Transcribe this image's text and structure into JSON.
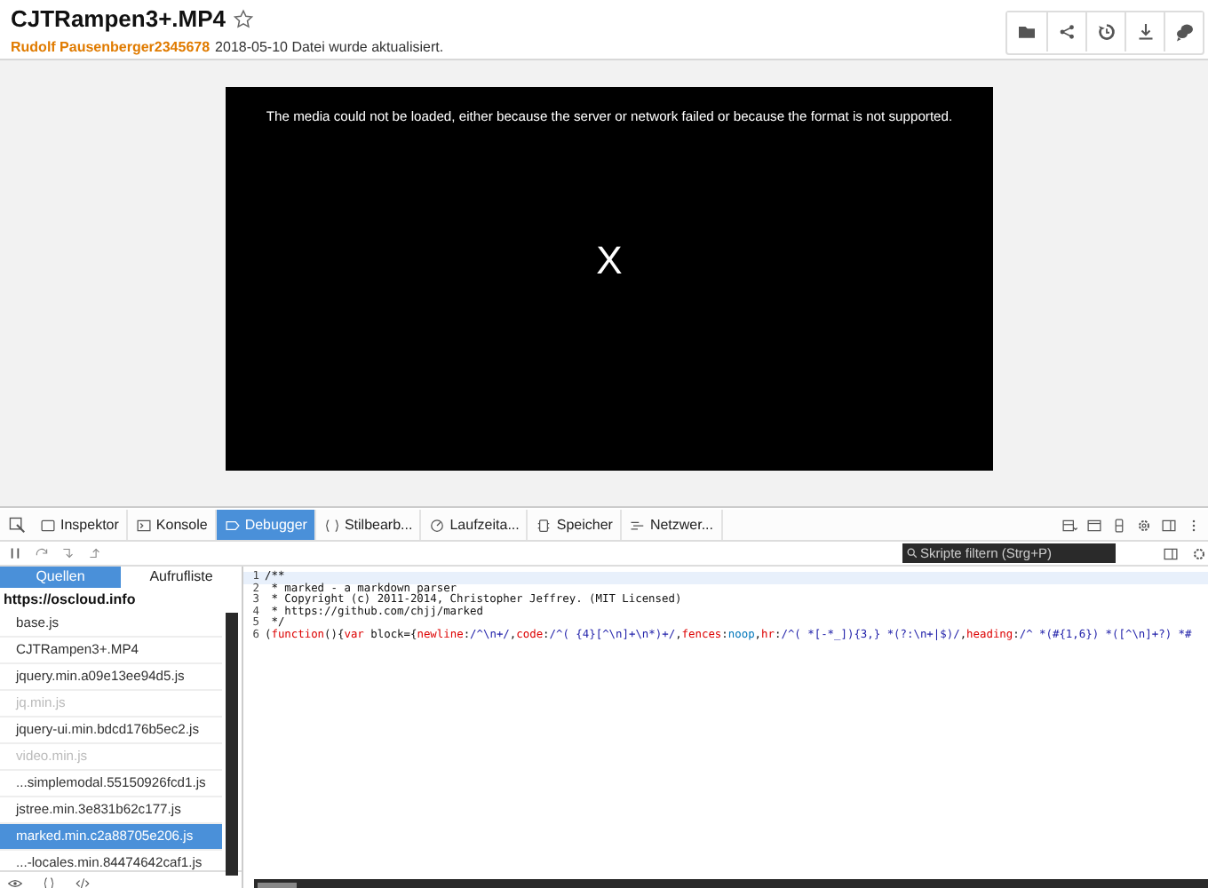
{
  "header": {
    "title": "CJTRampen3+.MP4",
    "author": "Rudolf Pausenberger2345678",
    "message": "2018-05-10 Datei wurde aktualisiert."
  },
  "player": {
    "error": "The media could not be loaded, either because the server or network failed or because the format is not supported.",
    "close_mark": "X"
  },
  "devtools": {
    "tabs": [
      {
        "label": "Inspektor",
        "kind": "inspector",
        "selected": false
      },
      {
        "label": "Konsole",
        "kind": "console",
        "selected": false
      },
      {
        "label": "Debugger",
        "kind": "debugger",
        "selected": true
      },
      {
        "label": "Stilbearb...",
        "kind": "style",
        "selected": false
      },
      {
        "label": "Laufzeita...",
        "kind": "perf",
        "selected": false
      },
      {
        "label": "Speicher",
        "kind": "memory",
        "selected": false
      },
      {
        "label": "Netzwer...",
        "kind": "network",
        "selected": false
      }
    ],
    "filter": {
      "placeholder": "Skripte filtern (Strg+P)"
    },
    "side_tabs": [
      {
        "label": "Quellen",
        "selected": true
      },
      {
        "label": "Aufrufliste",
        "selected": false
      }
    ],
    "origin": "https://oscloud.info",
    "sources": [
      {
        "name": "base.js",
        "selected": false,
        "disabled": false
      },
      {
        "name": "CJTRampen3+.MP4",
        "selected": false,
        "disabled": false
      },
      {
        "name": "jquery.min.a09e13ee94d5.js",
        "selected": false,
        "disabled": false
      },
      {
        "name": "jq.min.js",
        "selected": false,
        "disabled": true
      },
      {
        "name": "jquery-ui.min.bdcd176b5ec2.js",
        "selected": false,
        "disabled": false
      },
      {
        "name": "video.min.js",
        "selected": false,
        "disabled": true
      },
      {
        "name": "...simplemodal.55150926fcd1.js",
        "selected": false,
        "disabled": false
      },
      {
        "name": "jstree.min.3e831b62c177.js",
        "selected": false,
        "disabled": false
      },
      {
        "name": "marked.min.c2a88705e206.js",
        "selected": true,
        "disabled": false
      },
      {
        "name": "...-locales.min.84474642caf1.js",
        "selected": false,
        "disabled": false
      }
    ],
    "code": [
      {
        "number": "1",
        "selected": true,
        "tokens": [
          {
            "kind": "plain",
            "text": "/**"
          }
        ]
      },
      {
        "number": "2",
        "selected": false,
        "tokens": [
          {
            "kind": "plain",
            "text": " * marked - a markdown parser"
          }
        ]
      },
      {
        "number": "3",
        "selected": false,
        "tokens": [
          {
            "kind": "plain",
            "text": " * Copyright (c) 2011-2014, Christopher Jeffrey. (MIT Licensed)"
          }
        ]
      },
      {
        "number": "4",
        "selected": false,
        "tokens": [
          {
            "kind": "plain",
            "text": " * https://github.com/chjj/marked"
          }
        ]
      },
      {
        "number": "5",
        "selected": false,
        "tokens": [
          {
            "kind": "plain",
            "text": " */"
          }
        ]
      },
      {
        "number": "6",
        "selected": false,
        "tokens": [
          {
            "kind": "plain",
            "text": "("
          },
          {
            "kind": "keyword",
            "text": "function"
          },
          {
            "kind": "plain",
            "text": "(){"
          },
          {
            "kind": "keyword",
            "text": "var"
          },
          {
            "kind": "plain",
            "text": " block={"
          },
          {
            "kind": "keyword",
            "text": "newline"
          },
          {
            "kind": "plain",
            "text": ":"
          },
          {
            "kind": "regex",
            "text": "/^\\n+/"
          },
          {
            "kind": "plain",
            "text": ","
          },
          {
            "kind": "keyword",
            "text": "code"
          },
          {
            "kind": "plain",
            "text": ":"
          },
          {
            "kind": "regex",
            "text": "/^( {4}[^\\n]+\\n*)+/"
          },
          {
            "kind": "plain",
            "text": ","
          },
          {
            "kind": "keyword",
            "text": "fences"
          },
          {
            "kind": "plain",
            "text": ":"
          },
          {
            "kind": "ident",
            "text": "noop"
          },
          {
            "kind": "plain",
            "text": ","
          },
          {
            "kind": "keyword",
            "text": "hr"
          },
          {
            "kind": "plain",
            "text": ":"
          },
          {
            "kind": "regex",
            "text": "/^( *[-*_]){3,} *(?:\\n+|$)/"
          },
          {
            "kind": "plain",
            "text": ","
          },
          {
            "kind": "keyword",
            "text": "heading"
          },
          {
            "kind": "plain",
            "text": ":"
          },
          {
            "kind": "regex",
            "text": "/^ *(#{1,6}) *([^\\n]+?) *#"
          }
        ]
      }
    ]
  }
}
